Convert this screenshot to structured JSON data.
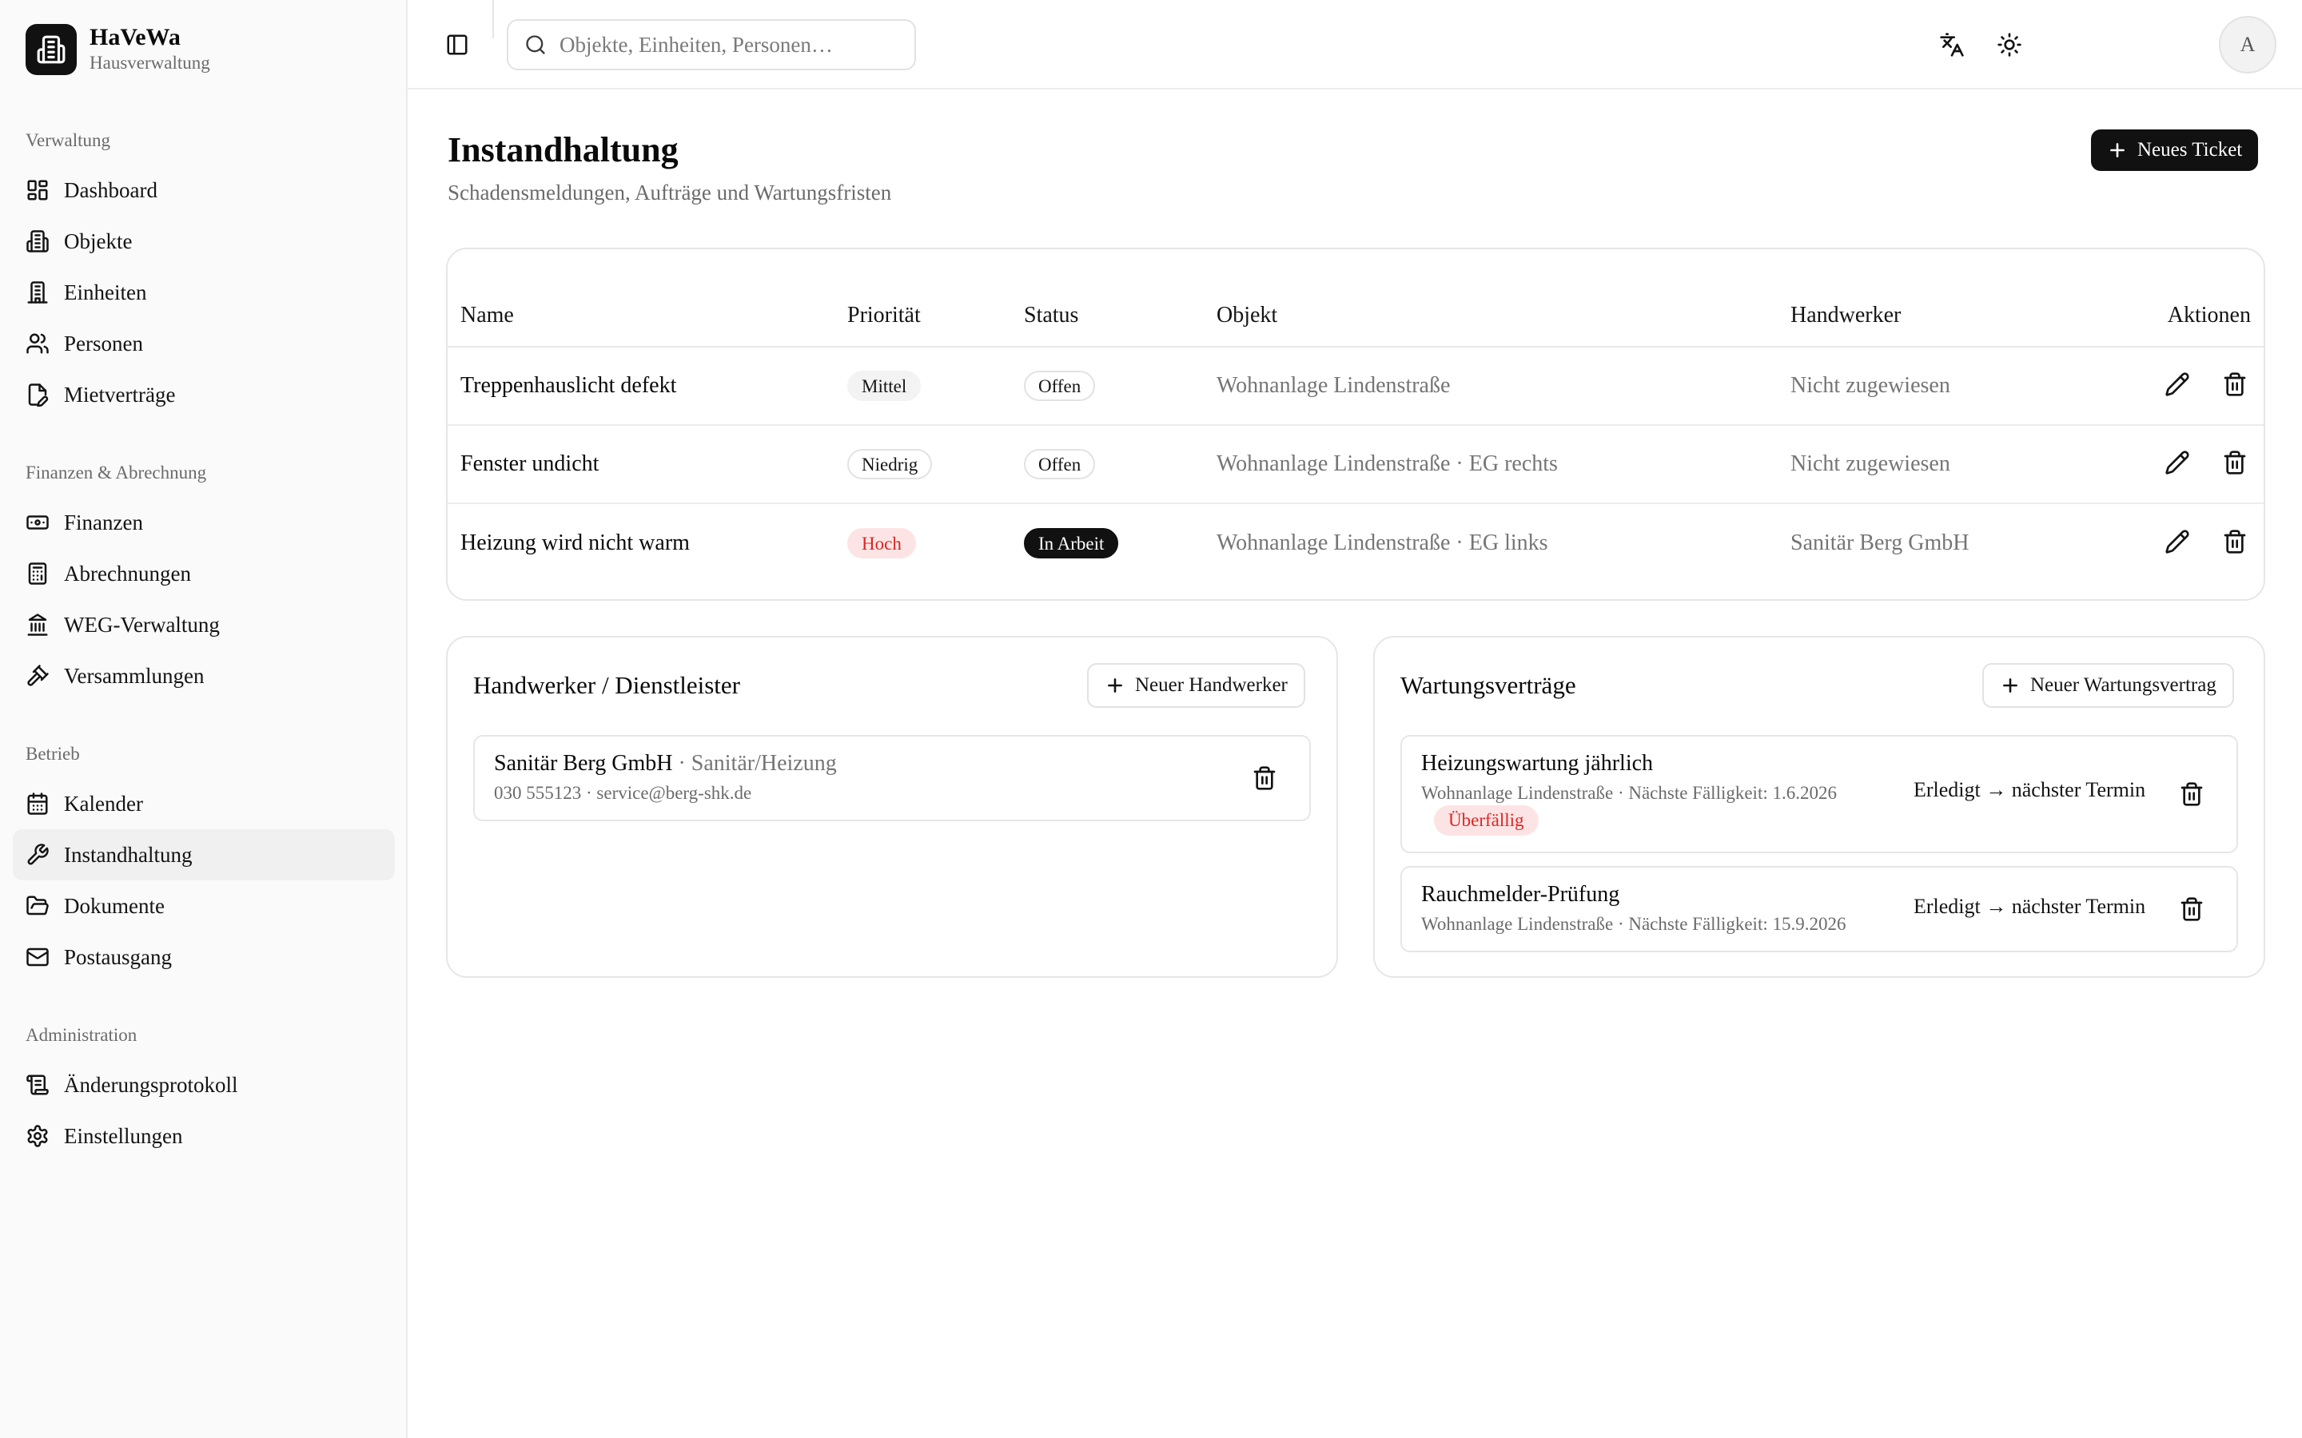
{
  "brand": {
    "name": "HaVeWa",
    "subtitle": "Hausverwaltung"
  },
  "sidebar": {
    "sections": [
      {
        "heading": "Verwaltung",
        "items": [
          {
            "label": "Dashboard",
            "icon": "dashboard-icon"
          },
          {
            "label": "Objekte",
            "icon": "building-icon"
          },
          {
            "label": "Einheiten",
            "icon": "building-2-icon"
          },
          {
            "label": "Personen",
            "icon": "users-icon"
          },
          {
            "label": "Mietverträge",
            "icon": "file-pen-icon"
          }
        ]
      },
      {
        "heading": "Finanzen & Abrechnung",
        "items": [
          {
            "label": "Finanzen",
            "icon": "banknote-icon"
          },
          {
            "label": "Abrechnungen",
            "icon": "calculator-icon"
          },
          {
            "label": "WEG-Verwaltung",
            "icon": "landmark-icon"
          },
          {
            "label": "Versammlungen",
            "icon": "gavel-icon"
          }
        ]
      },
      {
        "heading": "Betrieb",
        "items": [
          {
            "label": "Kalender",
            "icon": "calendar-icon"
          },
          {
            "label": "Instandhaltung",
            "icon": "wrench-icon",
            "active": true
          },
          {
            "label": "Dokumente",
            "icon": "folder-open-icon"
          },
          {
            "label": "Postausgang",
            "icon": "mail-icon"
          }
        ]
      },
      {
        "heading": "Administration",
        "items": [
          {
            "label": "Änderungsprotokoll",
            "icon": "scroll-icon"
          },
          {
            "label": "Einstellungen",
            "icon": "settings-icon"
          }
        ]
      }
    ]
  },
  "topbar": {
    "search_placeholder": "Objekte, Einheiten, Personen…",
    "avatar_initial": "A"
  },
  "page": {
    "title": "Instandhaltung",
    "subtitle": "Schadensmeldungen, Aufträge und Wartungsfristen",
    "new_ticket_label": "Neues Ticket"
  },
  "tickets": {
    "columns": [
      "Name",
      "Priorität",
      "Status",
      "Objekt",
      "Handwerker",
      "Aktionen"
    ],
    "rows": [
      {
        "name": "Treppenhauslicht defekt",
        "priority": "Mittel",
        "status": "Offen",
        "object": "Wohnanlage Lindenstraße",
        "craftsman": "Nicht zugewiesen"
      },
      {
        "name": "Fenster undicht",
        "priority": "Niedrig",
        "status": "Offen",
        "object": "Wohnanlage Lindenstraße · EG rechts",
        "craftsman": "Nicht zugewiesen"
      },
      {
        "name": "Heizung wird nicht warm",
        "priority": "Hoch",
        "status": "In Arbeit",
        "object": "Wohnanlage Lindenstraße · EG links",
        "craftsman": "Sanitär Berg GmbH"
      }
    ]
  },
  "craftsmen": {
    "title": "Handwerker / Dienstleister",
    "new_label": "Neuer Handwerker",
    "items": [
      {
        "name": "Sanitär Berg GmbH",
        "trade": "· Sanitär/Heizung",
        "contact": "030 555123 · service@berg-shk.de"
      }
    ]
  },
  "maintenance": {
    "title": "Wartungsverträge",
    "new_label": "Neuer Wartungsvertrag",
    "items": [
      {
        "title": "Heizungswartung jährlich",
        "meta": "Wohnanlage Lindenstraße · Nächste Fälligkeit: 1.6.2026",
        "badge": "Überfällig",
        "action": "Erledigt → nächster Termin"
      },
      {
        "title": "Rauchmelder-Prüfung",
        "meta": "Wohnanlage Lindenstraße · Nächste Fälligkeit: 15.9.2026",
        "action": "Erledigt → nächster Termin"
      }
    ]
  },
  "colors": {
    "accent": "#111111",
    "danger": "#d92626",
    "danger_bg": "#fde4e4",
    "muted": "#6b6b6b"
  }
}
